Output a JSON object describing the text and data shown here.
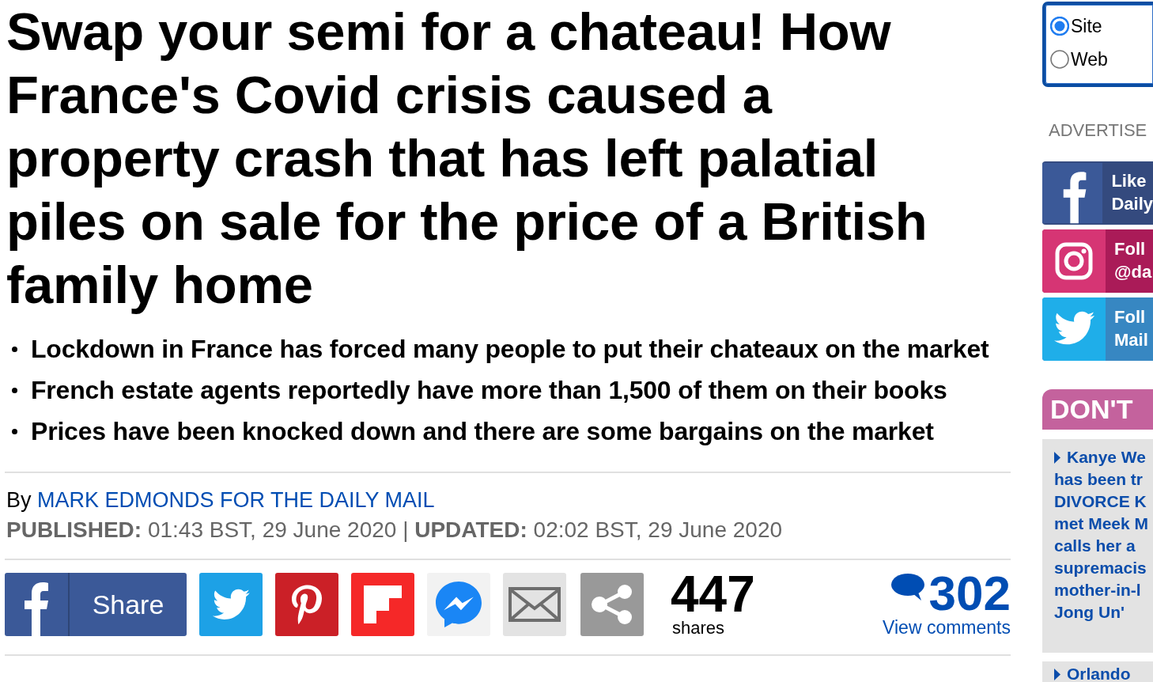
{
  "article": {
    "headline": "Swap your semi for a chateau! How France's Covid crisis caused a property crash that has left palatial piles on sale for the price of a British family home",
    "bullets": [
      "Lockdown in France has forced many people to put their chateaux on the market",
      "French estate agents reportedly have more than 1,500 of them on their books",
      "Prices have been knocked down and there are some bargains on the market"
    ],
    "byline": {
      "prefix": "By",
      "author": "MARK EDMONDS FOR THE DAILY MAIL"
    },
    "dateline": "**PUBLISHED:** 01:43 BST, 29 June 2020 | **UPDATED:** 02:02 BST, 29 June 2020"
  },
  "share_bar": {
    "buttons": [
      {
        "kind": "facebook",
        "label": "Share"
      },
      {
        "kind": "twitter"
      },
      {
        "kind": "pinterest"
      },
      {
        "kind": "flipboard"
      },
      {
        "kind": "messenger"
      },
      {
        "kind": "email"
      },
      {
        "kind": "more"
      }
    ],
    "share_count": "447",
    "share_count_label": "shares",
    "comment_count": "302",
    "comments_link": "View comments"
  },
  "sidebar": {
    "search_scope": [
      {
        "label": "Site",
        "selected": true
      },
      {
        "label": "Web",
        "selected": false
      }
    ],
    "advert_label": "ADVERTISE",
    "social": [
      {
        "kind": "facebook",
        "lines": [
          "Like",
          "Daily"
        ]
      },
      {
        "kind": "instagram",
        "lines": [
          "Foll",
          "@da"
        ]
      },
      {
        "kind": "twitter",
        "lines": [
          "Foll",
          "Mail"
        ]
      }
    ],
    "dont_miss": {
      "title": "DON'T",
      "stories": [
        {
          "lines": [
            "Kanye We",
            "has been tr",
            "DIVORCE K",
            "met Meek M",
            "calls her a",
            "supremacis",
            "mother-in-l",
            "Jong Un'"
          ]
        },
        {
          "lines": [
            "Orlando"
          ]
        }
      ]
    }
  }
}
